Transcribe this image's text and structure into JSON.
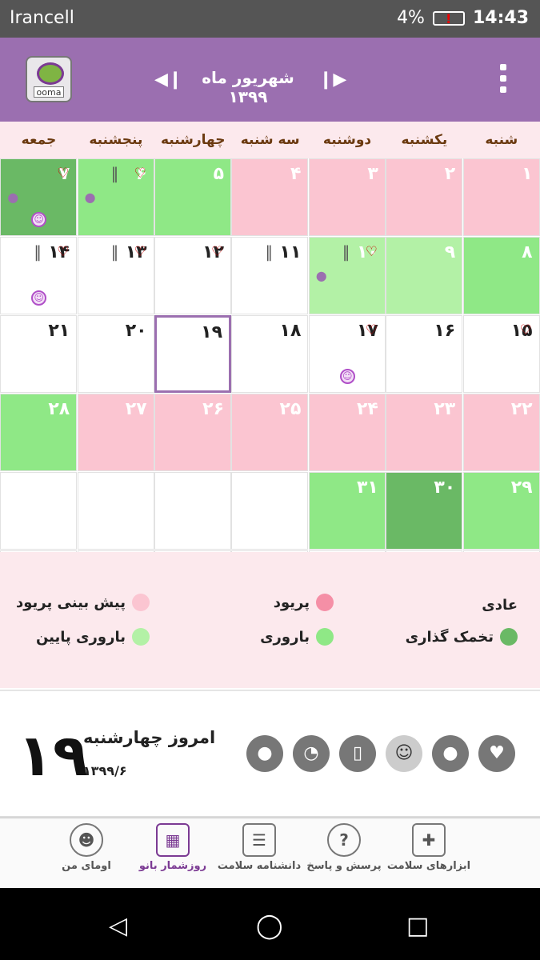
{
  "status": {
    "carrier": "Irancell",
    "battery": "4%",
    "time": "14:43"
  },
  "header": {
    "title": "شهریور ماه ۱۳۹۹",
    "logo_text": "ooma"
  },
  "colors": {
    "pink": "#fbc5d1",
    "light_green": "#b3f1a6",
    "green": "#8fe886",
    "dark_green": "#6ab965",
    "white": "#ffffff",
    "today_border": "#9b6fb0"
  },
  "weekdays": [
    "شنبه",
    "یکشنبه",
    "دوشنبه",
    "سه شنبه",
    "چهارشنبه",
    "پنجشنبه",
    "جمعه"
  ],
  "calendar": {
    "rows": [
      [
        {
          "label": "۱",
          "color": "pink",
          "heart": false,
          "clip": false,
          "drop": false,
          "smile": false
        },
        {
          "label": "۲",
          "color": "pink",
          "heart": false,
          "clip": false,
          "drop": false,
          "smile": false
        },
        {
          "label": "۳",
          "color": "pink",
          "heart": false,
          "clip": false,
          "drop": false,
          "smile": false
        },
        {
          "label": "۴",
          "color": "pink",
          "heart": false,
          "clip": false,
          "drop": false,
          "smile": false
        },
        {
          "label": "۵",
          "color": "green",
          "heart": false,
          "clip": false,
          "drop": false,
          "smile": false
        },
        {
          "label": "۶",
          "color": "green",
          "heart": true,
          "clip": true,
          "drop": true,
          "smile": false
        },
        {
          "label": "۷",
          "color": "dark_green",
          "heart": true,
          "clip": false,
          "drop": true,
          "smile": true
        }
      ],
      [
        {
          "label": "۸",
          "color": "green",
          "heart": false,
          "clip": false,
          "drop": false,
          "smile": false
        },
        {
          "label": "۹",
          "color": "light_green",
          "heart": false,
          "clip": false,
          "drop": false,
          "smile": false
        },
        {
          "label": "۱۰",
          "color": "light_green",
          "heart": true,
          "clip": true,
          "drop": true,
          "smile": false
        },
        {
          "label": "۱۱",
          "color": "white",
          "heart": false,
          "clip": true,
          "drop": false,
          "smile": false
        },
        {
          "label": "۱۲",
          "color": "white",
          "heart": true,
          "clip": false,
          "drop": false,
          "smile": false
        },
        {
          "label": "۱۳",
          "color": "white",
          "heart": true,
          "clip": true,
          "drop": false,
          "smile": false
        },
        {
          "label": "۱۴",
          "color": "white",
          "heart": true,
          "clip": true,
          "drop": false,
          "smile": true
        }
      ],
      [
        {
          "label": "۱۵",
          "color": "white",
          "heart": true,
          "clip": false,
          "drop": false,
          "smile": false
        },
        {
          "label": "۱۶",
          "color": "white",
          "heart": false,
          "clip": false,
          "drop": false,
          "smile": false
        },
        {
          "label": "۱۷",
          "color": "white",
          "heart": true,
          "clip": false,
          "drop": false,
          "smile": true
        },
        {
          "label": "۱۸",
          "color": "white",
          "heart": false,
          "clip": false,
          "drop": false,
          "smile": false
        },
        {
          "label": "۱۹",
          "color": "white",
          "heart": false,
          "clip": false,
          "drop": false,
          "smile": false,
          "today": true
        },
        {
          "label": "۲۰",
          "color": "white",
          "heart": false,
          "clip": false,
          "drop": false,
          "smile": false
        },
        {
          "label": "۲۱",
          "color": "white",
          "heart": false,
          "clip": false,
          "drop": false,
          "smile": false
        }
      ],
      [
        {
          "label": "۲۲",
          "color": "pink",
          "heart": false,
          "clip": false,
          "drop": false,
          "smile": false
        },
        {
          "label": "۲۳",
          "color": "pink",
          "heart": false,
          "clip": false,
          "drop": false,
          "smile": false
        },
        {
          "label": "۲۴",
          "color": "pink",
          "heart": false,
          "clip": false,
          "drop": false,
          "smile": false
        },
        {
          "label": "۲۵",
          "color": "pink",
          "heart": false,
          "clip": false,
          "drop": false,
          "smile": false
        },
        {
          "label": "۲۶",
          "color": "pink",
          "heart": false,
          "clip": false,
          "drop": false,
          "smile": false
        },
        {
          "label": "۲۷",
          "color": "pink",
          "heart": false,
          "clip": false,
          "drop": false,
          "smile": false
        },
        {
          "label": "۲۸",
          "color": "green",
          "heart": false,
          "clip": false,
          "drop": false,
          "smile": false
        }
      ],
      [
        {
          "label": "۲۹",
          "color": "green",
          "heart": false,
          "clip": false,
          "drop": false,
          "smile": false
        },
        {
          "label": "۳۰",
          "color": "dark_green",
          "heart": false,
          "clip": false,
          "drop": false,
          "smile": false
        },
        {
          "label": "۳۱",
          "color": "green",
          "heart": false,
          "clip": false,
          "drop": false,
          "smile": false
        },
        {
          "label": "",
          "color": "white",
          "heart": false,
          "clip": false,
          "drop": false,
          "smile": false
        },
        {
          "label": "",
          "color": "white",
          "heart": false,
          "clip": false,
          "drop": false,
          "smile": false
        },
        {
          "label": "",
          "color": "white",
          "heart": false,
          "clip": false,
          "drop": false,
          "smile": false
        },
        {
          "label": "",
          "color": "white",
          "heart": false,
          "clip": false,
          "drop": false,
          "smile": false
        }
      ],
      [
        {
          "label": "",
          "color": "white"
        },
        {
          "label": "",
          "color": "white"
        },
        {
          "label": "",
          "color": "white"
        },
        {
          "label": "",
          "color": "white"
        },
        {
          "label": "",
          "color": "white"
        },
        {
          "label": "",
          "color": "white"
        },
        {
          "label": "",
          "color": "white"
        }
      ]
    ]
  },
  "legend": {
    "normal": "عادی",
    "period": "پریود",
    "period_prediction": "پیش بینی پریود",
    "ovulation": "تخمک گذاری",
    "fertility": "باروری",
    "low_fertility": "باروری پایین"
  },
  "today": {
    "number": "۱۹",
    "label": "امروز چهارشنبه",
    "date": "۱۳۹۹/۶"
  },
  "tools": [
    "heart-icon",
    "pill-icon",
    "mood-icon",
    "thermometer-icon",
    "gauge-icon",
    "drop-icon"
  ],
  "bottom_nav": {
    "health_tools": "ابزارهای سلامت",
    "qa": "پرسش و پاسخ",
    "encyclopedia": "دانشنامه سلامت",
    "calendar": "روزشمار بانو",
    "my_ooma": "اومای من"
  }
}
